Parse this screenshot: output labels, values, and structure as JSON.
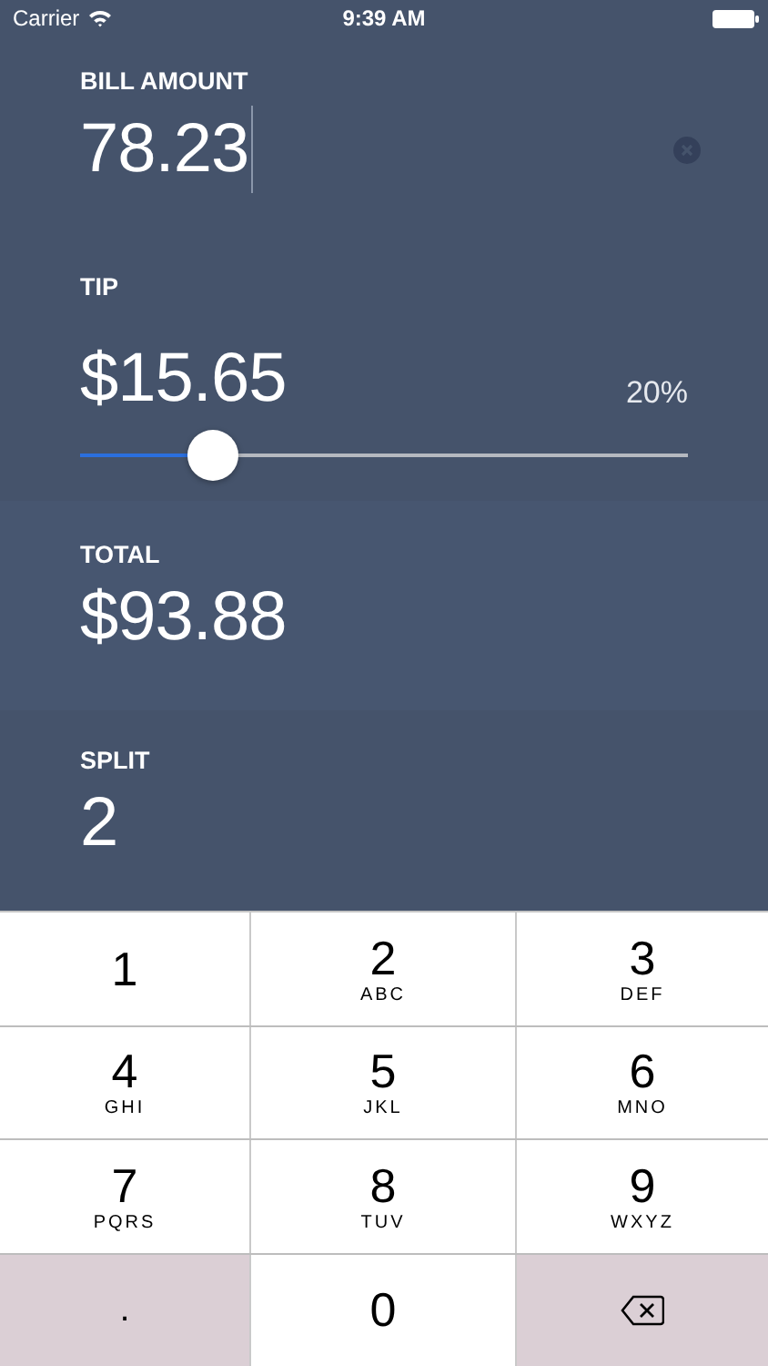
{
  "status_bar": {
    "carrier": "Carrier",
    "time": "9:39 AM"
  },
  "bill": {
    "label": "BILL AMOUNT",
    "value": "78.23"
  },
  "tip": {
    "label": "TIP",
    "amount": "$15.65",
    "percent": "20%",
    "level": 0.22
  },
  "total": {
    "label": "TOTAL",
    "value": "$93.88"
  },
  "split": {
    "label": "SPLIT",
    "value": "2"
  },
  "keypad": [
    {
      "kind": "digit",
      "digit": "1"
    },
    {
      "kind": "digit",
      "digit": "2",
      "letters": "ABC"
    },
    {
      "kind": "digit",
      "digit": "3",
      "letters": "DEF"
    },
    {
      "kind": "digit",
      "digit": "4",
      "letters": "GHI"
    },
    {
      "kind": "digit",
      "digit": "5",
      "letters": "JKL"
    },
    {
      "kind": "digit",
      "digit": "6",
      "letters": "MNO"
    },
    {
      "kind": "digit",
      "digit": "7",
      "letters": "PQRS"
    },
    {
      "kind": "digit",
      "digit": "8",
      "letters": "TUV"
    },
    {
      "kind": "digit",
      "digit": "9",
      "letters": "WXYZ"
    },
    {
      "kind": "dot",
      "digit": "."
    },
    {
      "kind": "digit",
      "digit": "0"
    },
    {
      "kind": "delete"
    }
  ]
}
